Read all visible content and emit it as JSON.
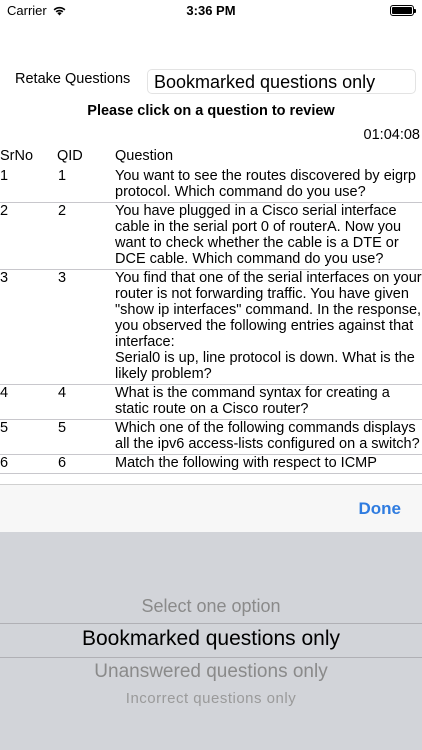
{
  "status_bar": {
    "carrier": "Carrier",
    "time": "3:36 PM"
  },
  "header": {
    "retake_label": "Retake Questions",
    "filter_value": "Bookmarked questions only",
    "instruction": "Please click on a question to review",
    "timer": "01:04:08"
  },
  "table": {
    "columns": [
      "SrNo",
      "QID",
      "Question"
    ],
    "rows": [
      {
        "srno": "1",
        "qid": "1",
        "question": "You want to see the routes discovered by eigrp protocol. Which command do you use?"
      },
      {
        "srno": "2",
        "qid": "2",
        "question": "You have plugged in a Cisco serial interface cable in the serial port 0 of routerA. Now you want to check whether the cable is a DTE or DCE cable. Which command do you use?"
      },
      {
        "srno": "3",
        "qid": "3",
        "question": "You find that one of the serial interfaces on your router is not forwarding traffic. You have given \"show ip interfaces\" command. In the response, you observed the following entries against that interface:\nSerial0 is up, line protocol is down. What is the likely problem?"
      },
      {
        "srno": "4",
        "qid": "4",
        "question": "What is the command syntax for creating a static route on a Cisco router?"
      },
      {
        "srno": "5",
        "qid": "5",
        "question": "Which one of the following commands displays all the ipv6 access-lists configured on a switch?"
      },
      {
        "srno": "6",
        "qid": "6",
        "question": "Match the following with respect to ICMP"
      }
    ]
  },
  "picker": {
    "done_label": "Done",
    "options": [
      "Select one option",
      "Bookmarked questions only",
      "Unanswered questions only",
      "Incorrect questions only"
    ],
    "selected_index": 1
  },
  "colors": {
    "accent": "#2f7ce0",
    "picker_bg": "#d2d4d9",
    "toolbar_bg": "#f7f7f7",
    "separator": "#c8c7cc"
  }
}
